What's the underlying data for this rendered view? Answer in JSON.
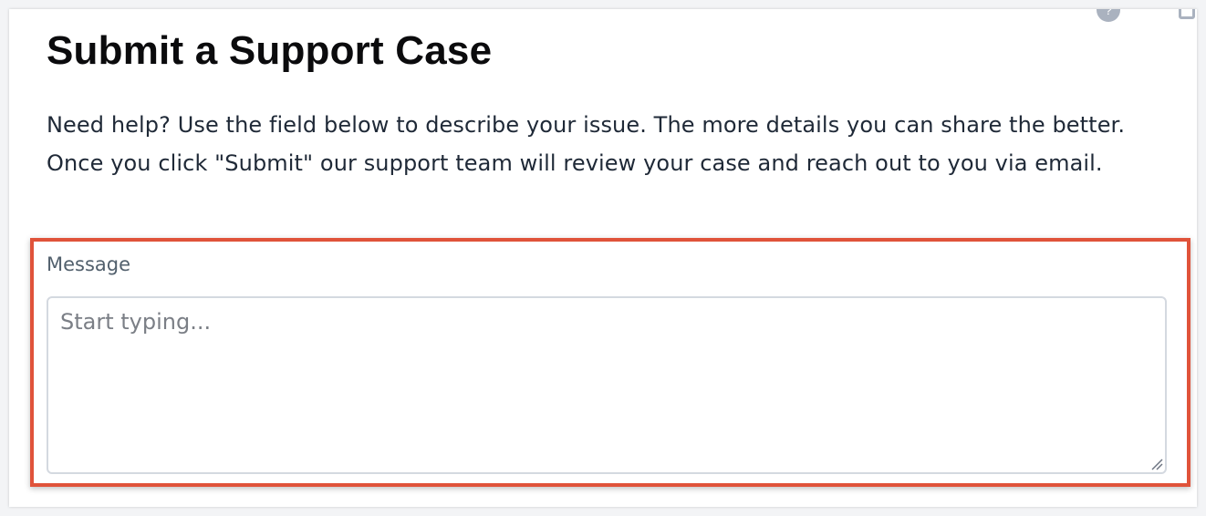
{
  "dialog": {
    "title": "Submit a Support Case",
    "intro": "Need help? Use the field below to describe your issue. The more details you can share the better. Once you click \"Submit\" our support team will review your case and reach out to you via email.",
    "icons": [
      "help-icon",
      "close-icon"
    ]
  },
  "message_field": {
    "label": "Message",
    "value": "",
    "placeholder": "Start typing..."
  },
  "colors": {
    "highlight_border": "#e0533a",
    "title_text": "#0b0b0d",
    "body_text": "#1f2937",
    "label_text": "#52606d",
    "input_border": "#d4d9e0",
    "placeholder_text": "#7b7f86",
    "icon_gray": "#aab2bf"
  }
}
